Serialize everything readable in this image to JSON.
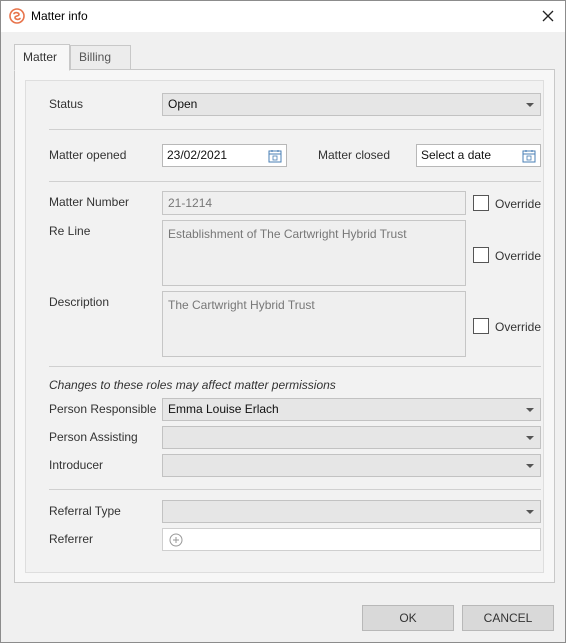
{
  "window": {
    "title": "Matter info",
    "close_glyph": "✕"
  },
  "tabs": [
    {
      "label": "Matter",
      "active": true
    },
    {
      "label": "Billing",
      "active": false
    }
  ],
  "form": {
    "status": {
      "label": "Status",
      "value": "Open"
    },
    "matter_opened": {
      "label": "Matter opened",
      "value": "23/02/2021"
    },
    "matter_closed": {
      "label": "Matter closed",
      "placeholder": "Select a date"
    },
    "matter_number": {
      "label": "Matter Number",
      "value": "21-1214",
      "override_label": "Override"
    },
    "re_line": {
      "label": "Re Line",
      "value": "Establishment of The Cartwright Hybrid Trust",
      "override_label": "Override"
    },
    "description": {
      "label": "Description",
      "value": "The Cartwright Hybrid Trust",
      "override_label": "Override"
    },
    "roles_note": "Changes to these roles may affect matter permissions",
    "person_responsible": {
      "label": "Person Responsible",
      "value": "Emma Louise Erlach"
    },
    "person_assisting": {
      "label": "Person Assisting",
      "value": ""
    },
    "introducer": {
      "label": "Introducer",
      "value": ""
    },
    "referral_type": {
      "label": "Referral Type",
      "value": ""
    },
    "referrer": {
      "label": "Referrer",
      "value": ""
    }
  },
  "buttons": {
    "ok": "OK",
    "cancel": "CANCEL"
  },
  "colors": {
    "logo_accent": "#e8734a",
    "window_bg": "#f0f0f0",
    "button_bg": "#d9d9d9"
  },
  "icons": [
    "app-logo-icon",
    "close-icon",
    "calendar-icon",
    "chevron-down-icon",
    "add-circle-icon"
  ]
}
